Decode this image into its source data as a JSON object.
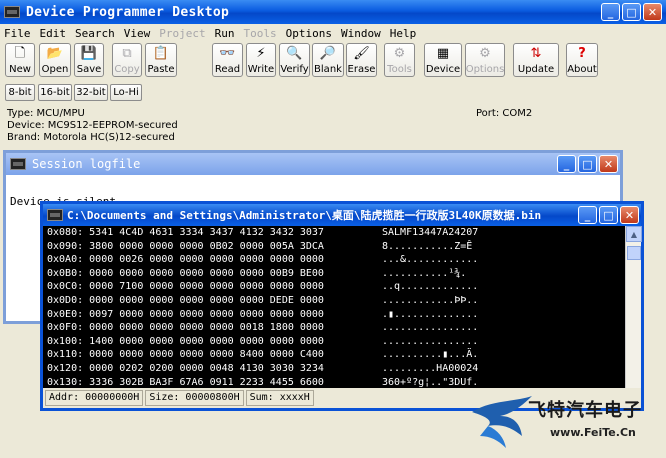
{
  "window": {
    "title": "Device Programmer Desktop"
  },
  "menu": [
    {
      "label": "File",
      "enabled": true
    },
    {
      "label": "Edit",
      "enabled": true
    },
    {
      "label": "Search",
      "enabled": true
    },
    {
      "label": "View",
      "enabled": true
    },
    {
      "label": "Project",
      "enabled": false
    },
    {
      "label": "Run",
      "enabled": true
    },
    {
      "label": "Tools",
      "enabled": false
    },
    {
      "label": "Options",
      "enabled": true
    },
    {
      "label": "Window",
      "enabled": true
    },
    {
      "label": "Help",
      "enabled": true
    }
  ],
  "toolbar": {
    "new": "New",
    "open": "Open",
    "save": "Save",
    "copy": "Copy",
    "paste": "Paste",
    "read": "Read",
    "write": "Write",
    "verify": "Verify",
    "blank": "Blank",
    "erase": "Erase",
    "tools": "Tools",
    "device": "Device",
    "options": "Options",
    "update": "Update",
    "about": "About"
  },
  "bitmode": {
    "b8": "8-bit",
    "b16": "16-bit",
    "b32": "32-bit",
    "lohi": "Lo-Hi"
  },
  "info": {
    "type": "Type: MCU/MPU",
    "device": "Device: MC9S12-EEPROM-secured",
    "brand": "Brand: Motorola HC(S)12-secured",
    "port": "Port: COM2"
  },
  "session": {
    "title": "Session logfile",
    "text": "Device is silent"
  },
  "hexwindow": {
    "title": "C:\\Documents and Settings\\Administrator\\桌面\\陆虎揽胜一行政版3L40K原数据.bin",
    "rows": [
      {
        "addr": "0x080:",
        "hex": "5341 4C4D 4631 3334 3437 4132 3432 3037",
        "ascii": "SALMF13447A24207"
      },
      {
        "addr": "0x090:",
        "hex": "3800 0000 0000 0000 0B02 0000 005A 3DCA",
        "ascii": "8...........Z=Ê"
      },
      {
        "addr": "0x0A0:",
        "hex": "0000 0026 0000 0000 0000 0000 0000 0000",
        "ascii": "...&............"
      },
      {
        "addr": "0x0B0:",
        "hex": "0000 0000 0000 0000 0000 0000 00B9 BE00",
        "ascii": "...........¹¾."
      },
      {
        "addr": "0x0C0:",
        "hex": "0000 7100 0000 0000 0000 0000 0000 0000",
        "ascii": "..q............."
      },
      {
        "addr": "0x0D0:",
        "hex": "0000 0000 0000 0000 0000 0000 DEDE 0000",
        "ascii": "............ÞÞ.."
      },
      {
        "addr": "0x0E0:",
        "hex": "0097 0000 0000 0000 0000 0000 0000 0000",
        "ascii": ".▮.............."
      },
      {
        "addr": "0x0F0:",
        "hex": "0000 0000 0000 0000 0000 0018 1800 0000",
        "ascii": "................"
      },
      {
        "addr": "0x100:",
        "hex": "1400 0000 0000 0000 0000 0000 0000 0000",
        "ascii": "................"
      },
      {
        "addr": "0x110:",
        "hex": "0000 0000 0000 0000 0000 8400 0000 C400",
        "ascii": "..........▮...Ä."
      },
      {
        "addr": "0x120:",
        "hex": "0000 0202 0200 0000 0048 4130 3030 3234",
        "ascii": ".........HA00024"
      },
      {
        "addr": "0x130:",
        "hex": "3336 302B BA3F 67A6 0911 2233 4455 6600",
        "ascii": "360+º?g¦..\"3DUf."
      }
    ],
    "status": {
      "addr": "Addr: 00000000H",
      "size": "Size: 00000800H",
      "sum": "Sum: xxxxH"
    }
  },
  "logo": {
    "cn": "飞特汽车电子",
    "en": "www.FeiTe.Cn"
  }
}
